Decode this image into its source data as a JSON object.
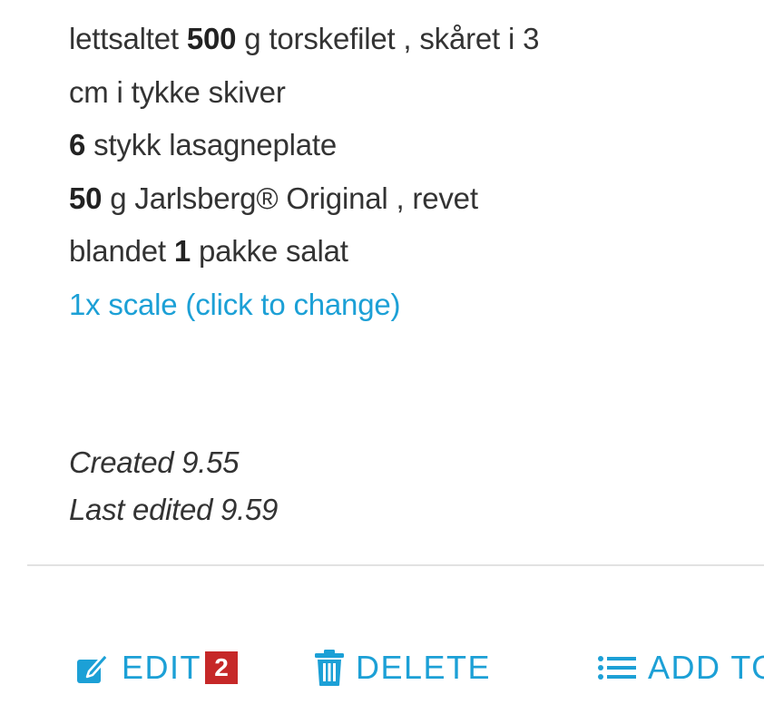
{
  "ingredients": [
    {
      "pre": "lettsaltet ",
      "qty": "500",
      "post": " g torskefilet , skåret i 3"
    },
    {
      "pre": "cm i tykke skiver",
      "qty": "",
      "post": ""
    },
    {
      "pre": "",
      "qty": "6",
      "post": " stykk lasagneplate"
    },
    {
      "pre": "",
      "qty": "50",
      "post": " g Jarlsberg® Original , revet"
    },
    {
      "pre": "blandet ",
      "qty": "1",
      "post": " pakke salat"
    }
  ],
  "scale_link": "1x scale (click to change)",
  "meta": {
    "created": "Created 9.55",
    "last_edited": "Last edited 9.59"
  },
  "actions": {
    "edit_label": "EDIT",
    "edit_badge": "2",
    "delete_label": "DELETE",
    "add_label": "ADD TO"
  },
  "colors": {
    "accent": "#1ca0d6",
    "badge": "#c62828",
    "text": "#333333"
  },
  "icons": {
    "edit": "edit-icon",
    "delete": "trash-icon",
    "add": "list-icon"
  }
}
